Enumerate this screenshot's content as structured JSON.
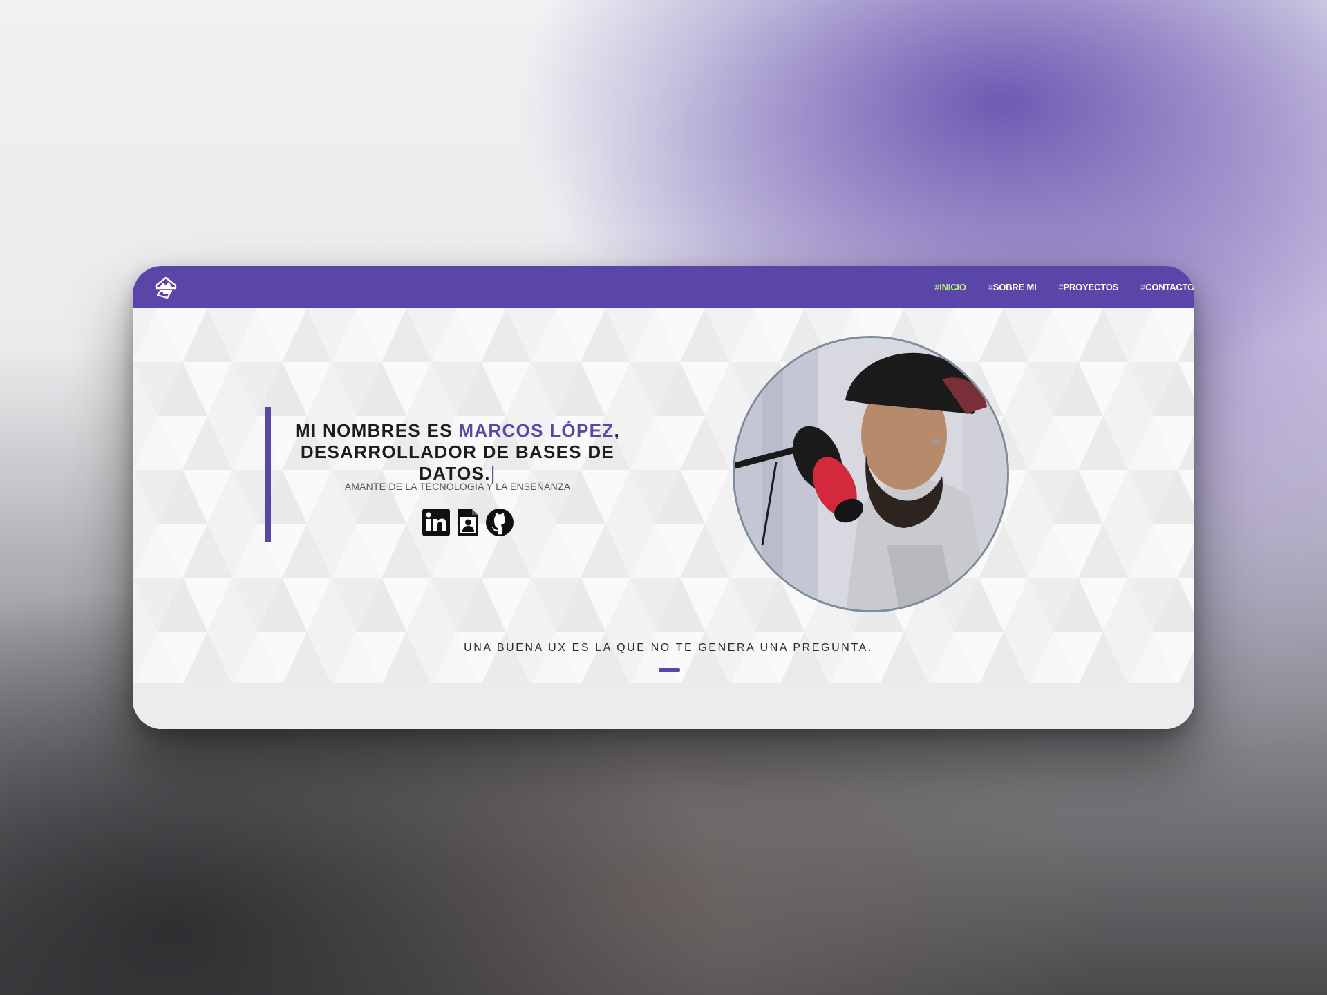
{
  "navbar": {
    "logo_icon": "mountain-house-logo-icon",
    "items": [
      {
        "hash": "#",
        "label": "INICIO",
        "active": true
      },
      {
        "hash": "#",
        "label": "SOBRE MI",
        "active": false
      },
      {
        "hash": "#",
        "label": "PROYECTOS",
        "active": false
      },
      {
        "hash": "#",
        "label": "CONTACTO",
        "active": false
      }
    ]
  },
  "hero": {
    "headline_prefix": "MI NOMBRES ES ",
    "headline_name": "MARCOS LÓPEZ",
    "headline_comma": ",",
    "headline_line2": "DESARROLLADOR DE BASES DE DATOS.",
    "headline_caret": "|",
    "tagline": "AMANTE DE LA TECNOLOGÍA Y LA ENSEÑANZA",
    "socials": [
      "linkedin-icon",
      "resume-contact-icon",
      "github-icon"
    ],
    "quote": "UNA BUENA UX ES LA QUE NO TE GENERA UNA PREGUNTA."
  },
  "colors": {
    "accent": "#5a46a8",
    "active_nav": "#b9ef7a"
  }
}
